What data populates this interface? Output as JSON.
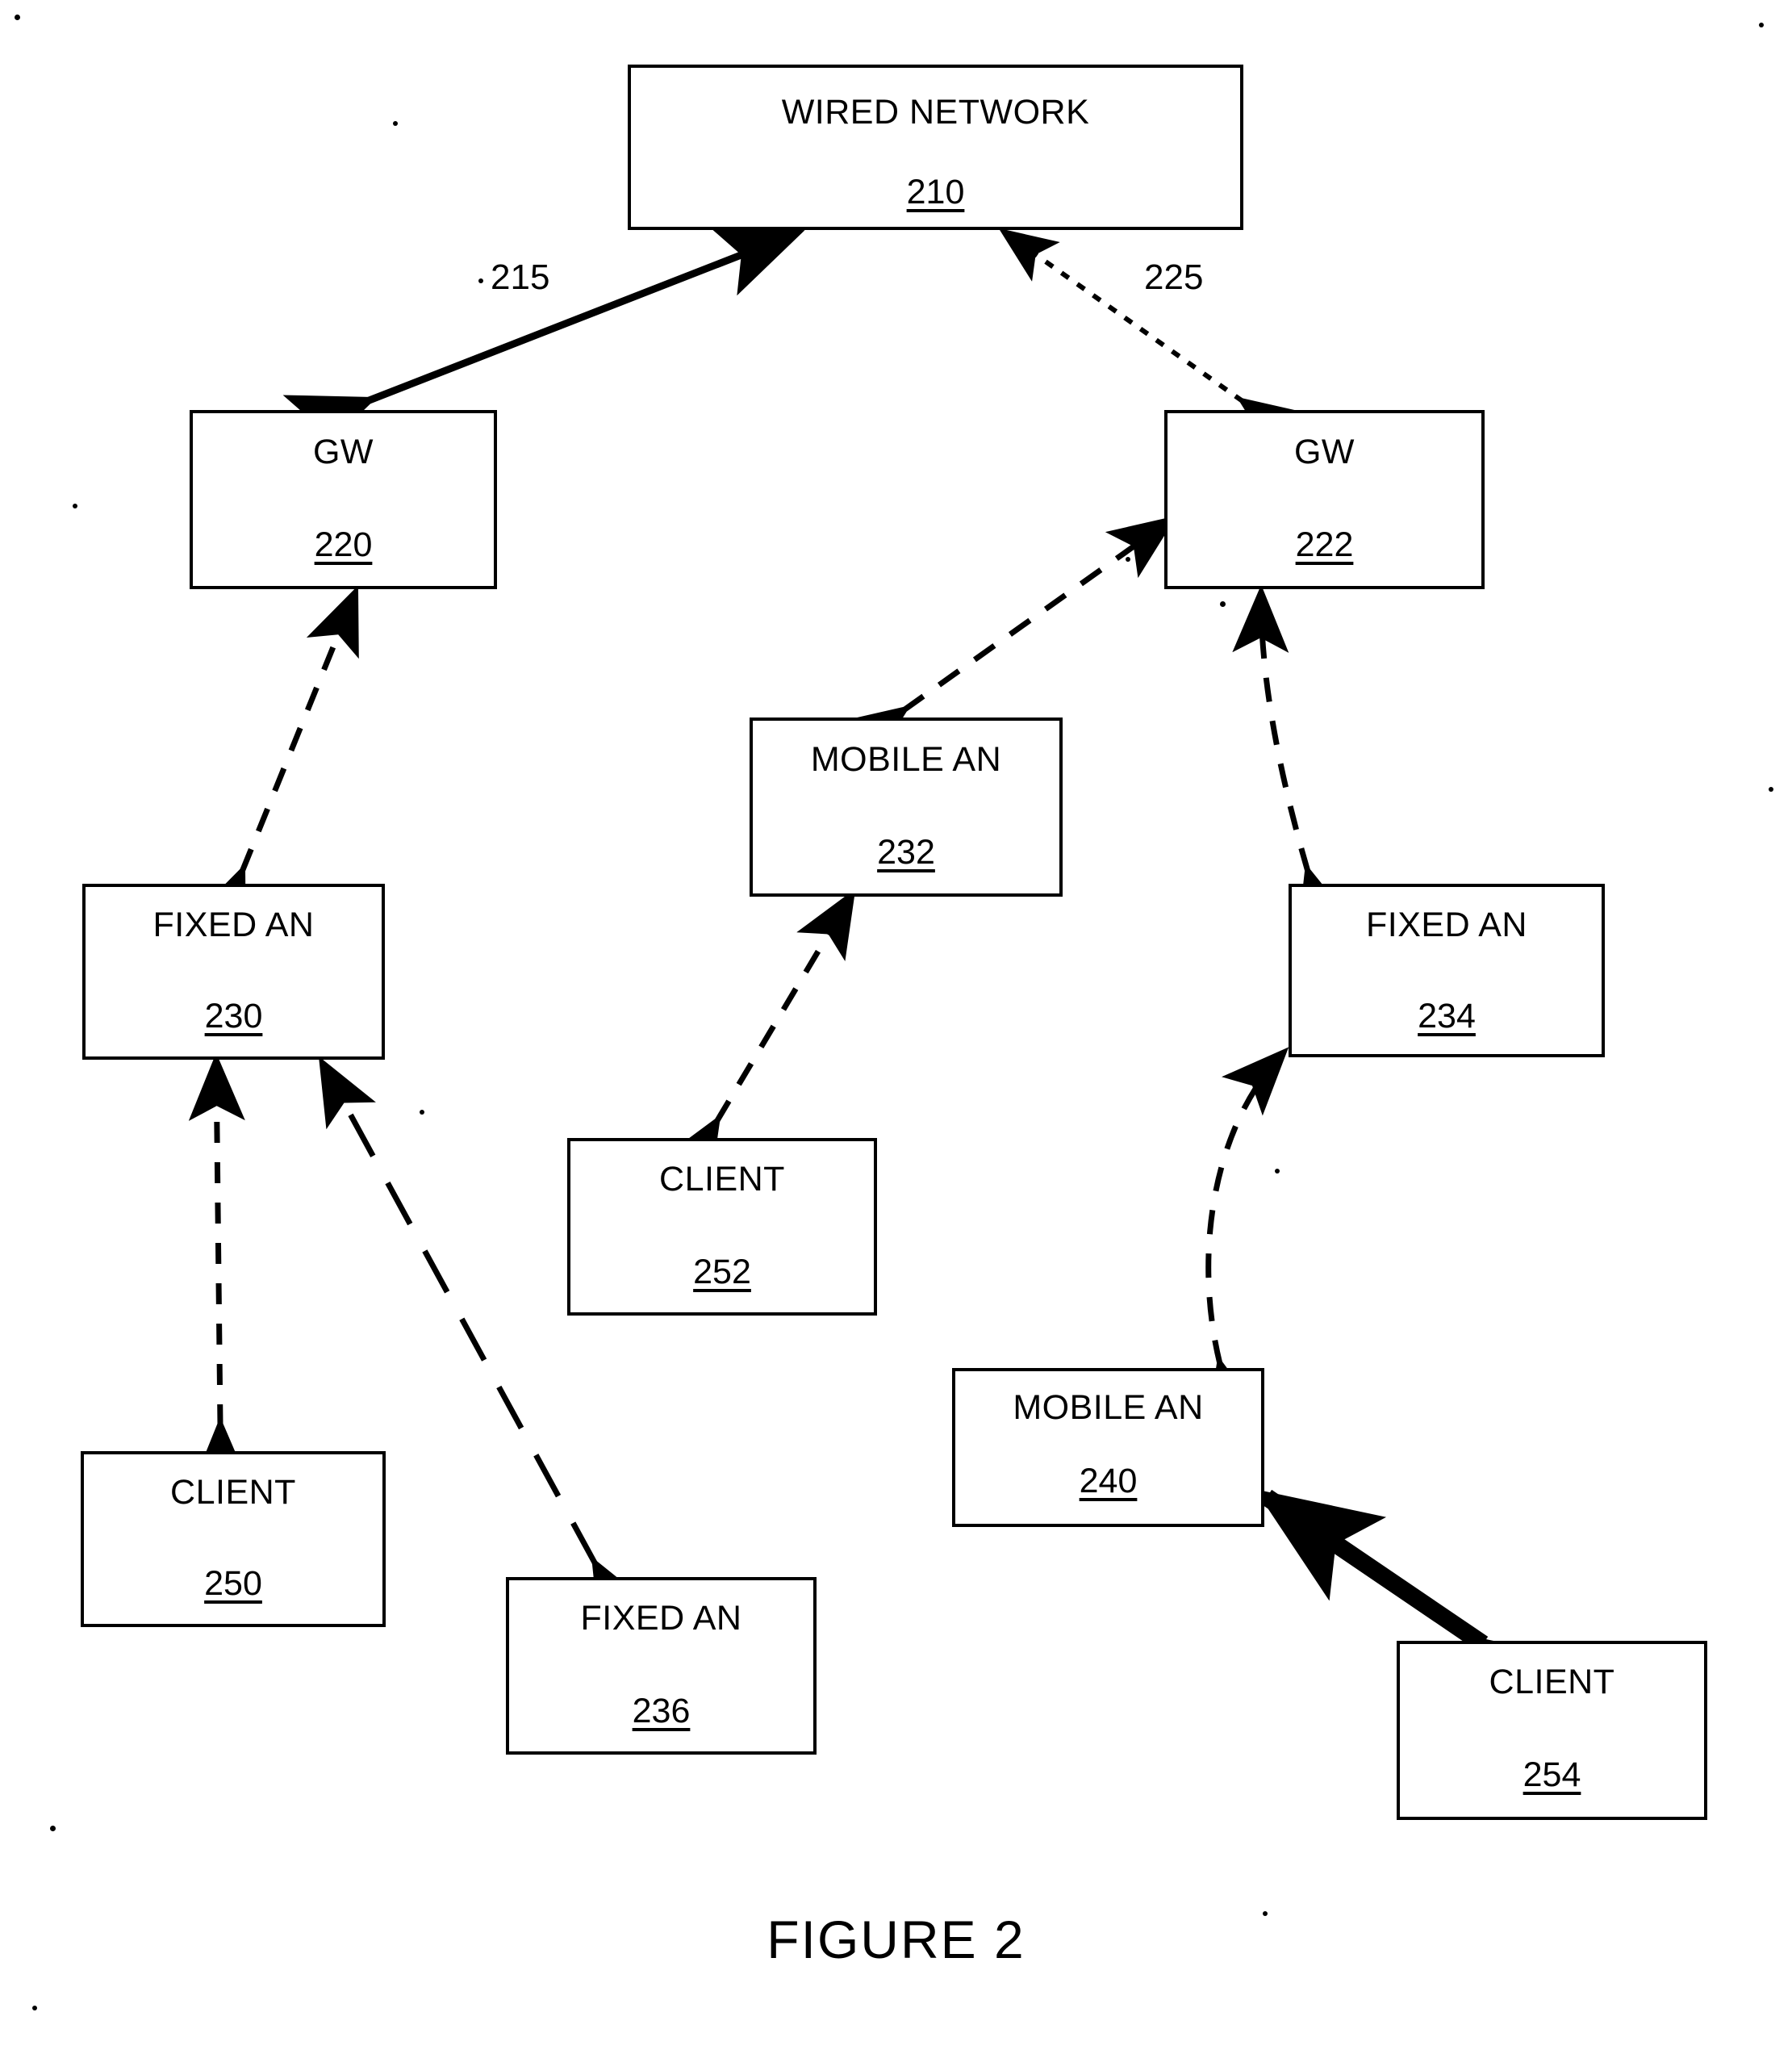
{
  "figure": {
    "caption": "FIGURE 2"
  },
  "nodes": [
    {
      "id": "wired-network",
      "title": "WIRED NETWORK",
      "ref": "210"
    },
    {
      "id": "gw-220",
      "title": "GW",
      "ref": "220"
    },
    {
      "id": "gw-222",
      "title": "GW",
      "ref": "222"
    },
    {
      "id": "mobile-an-232",
      "title": "MOBILE AN",
      "ref": "232"
    },
    {
      "id": "fixed-an-230",
      "title": "FIXED AN",
      "ref": "230"
    },
    {
      "id": "fixed-an-234",
      "title": "FIXED AN",
      "ref": "234"
    },
    {
      "id": "client-252",
      "title": "CLIENT",
      "ref": "252"
    },
    {
      "id": "client-250",
      "title": "CLIENT",
      "ref": "250"
    },
    {
      "id": "fixed-an-236",
      "title": "FIXED AN",
      "ref": "236"
    },
    {
      "id": "mobile-an-240",
      "title": "MOBILE AN",
      "ref": "240"
    },
    {
      "id": "client-254",
      "title": "CLIENT",
      "ref": "254"
    }
  ],
  "edge_labels": [
    {
      "id": "edge-label-215",
      "text": "215"
    },
    {
      "id": "edge-label-225",
      "text": "225"
    }
  ],
  "chart_data": {
    "type": "diagram",
    "title": "FIGURE 2",
    "nodes": [
      {
        "ref": "210",
        "label": "WIRED NETWORK"
      },
      {
        "ref": "220",
        "label": "GW"
      },
      {
        "ref": "222",
        "label": "GW"
      },
      {
        "ref": "230",
        "label": "FIXED AN"
      },
      {
        "ref": "232",
        "label": "MOBILE AN"
      },
      {
        "ref": "234",
        "label": "FIXED AN"
      },
      {
        "ref": "236",
        "label": "FIXED AN"
      },
      {
        "ref": "240",
        "label": "MOBILE AN"
      },
      {
        "ref": "250",
        "label": "CLIENT"
      },
      {
        "ref": "252",
        "label": "CLIENT"
      },
      {
        "ref": "254",
        "label": "CLIENT"
      }
    ],
    "edges": [
      {
        "from": "220",
        "to": "210",
        "style": "solid-thick",
        "arrows": "both",
        "label": "215"
      },
      {
        "from": "222",
        "to": "210",
        "style": "dotted",
        "arrows": "both",
        "label": "225"
      },
      {
        "from": "230",
        "to": "220",
        "style": "dashed",
        "arrows": "both",
        "label": ""
      },
      {
        "from": "232",
        "to": "222",
        "style": "dashed",
        "arrows": "both",
        "label": ""
      },
      {
        "from": "234",
        "to": "222",
        "style": "dashed-curved",
        "arrows": "both",
        "label": ""
      },
      {
        "from": "250",
        "to": "230",
        "style": "dashed",
        "arrows": "both",
        "label": ""
      },
      {
        "from": "236",
        "to": "230",
        "style": "dashed-long",
        "arrows": "both",
        "label": ""
      },
      {
        "from": "252",
        "to": "232",
        "style": "dashed",
        "arrows": "both",
        "label": ""
      },
      {
        "from": "240",
        "to": "234",
        "style": "dashed-curved",
        "arrows": "both",
        "label": ""
      },
      {
        "from": "254",
        "to": "240",
        "style": "solid-thick",
        "arrows": "both",
        "label": ""
      }
    ]
  }
}
